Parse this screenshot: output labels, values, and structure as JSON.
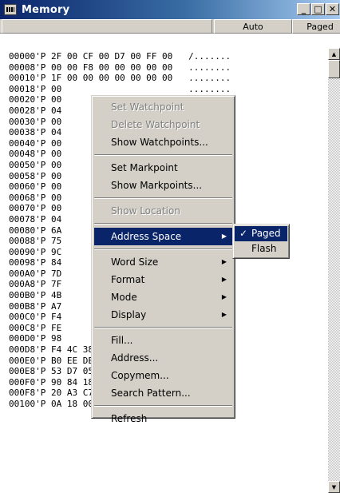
{
  "window": {
    "title": "Memory",
    "buttons": {
      "minimize": "_",
      "maximize": "□",
      "close": "✕"
    }
  },
  "header": {
    "blank": "",
    "auto": "Auto",
    "paged": "Paged"
  },
  "rows": [
    "00000'P 2F 00 CF 00 D7 00 FF 00   /.......",
    "00008'P 00 00 F8 00 00 00 00 00   ........",
    "00010'P 1F 00 00 00 00 00 00 00   ........",
    "00018'P 00                        ........",
    "00020'P 00                        ........",
    "00028'P 04                        ... ....",
    "00030'P 00                        ........",
    "00038'P 04                        .@......",
    "00040'P 00                        ........",
    "00048'P 00                        ........",
    "00050'P 00                        ........",
    "00058'P 00                        ........",
    "00060'P 00                        ........",
    "00068'P 00                        ........",
    "00070'P 00                        ........",
    "00078'P 04                        ........",
    "00080'P 6A                        j...> ..",
    "00088'P 75                        u.7X}f..",
    "00090'P 9C                        ...r....",
    "00098'P 84                        .......F",
    "000A0'P 7D                        }Iu.....",
    "000A8'P 7F                        ........",
    "000B0'P 4B                        K.......",
    "000B8'P A7                        ..]..@..",
    "000C0'P F4                        ......Jq",
    "000C8'P FE                        .E.4m...",
    "000D0'P 98                        ....1.B%",
    "000D8'P F4 4C 38 20 70 52 09 4F   .L8 pR.O",
    "000E0'P B0 EE DE 7F 7E 9D 36 6E   ....~.6n",
    "000E8'P 53 D7 05 29 AE 0E 97 69   S..)...i",
    "000F0'P 90 84 18 94 14 68 5B A4   .....h[.",
    "000F8'P 20 A3 C7 C3 08 8C 24 88    .....$.",
    "00100'P 0A 18 00 13 26 58 63 FC   ....&Xc."
  ],
  "menu": {
    "set_watchpoint": "Set Watchpoint",
    "delete_watchpoint": "Delete Watchpoint",
    "show_watchpoints": "Show Watchpoints...",
    "set_markpoint": "Set Markpoint",
    "show_markpoints": "Show Markpoints...",
    "show_location": "Show Location",
    "address_space": "Address Space",
    "word_size": "Word Size",
    "format": "Format",
    "mode": "Mode",
    "display": "Display",
    "fill": "Fill...",
    "address": "Address...",
    "copymem": "Copymem...",
    "search_pattern": "Search Pattern...",
    "refresh": "Refresh"
  },
  "submenu": {
    "paged": "Paged",
    "flash": "Flash",
    "check": "✓"
  },
  "icons": {
    "arrow": "▶",
    "scroll_up": "▲",
    "scroll_down": "▼"
  },
  "colors": {
    "highlight": "#0a246a",
    "face": "#d4d0c8"
  }
}
